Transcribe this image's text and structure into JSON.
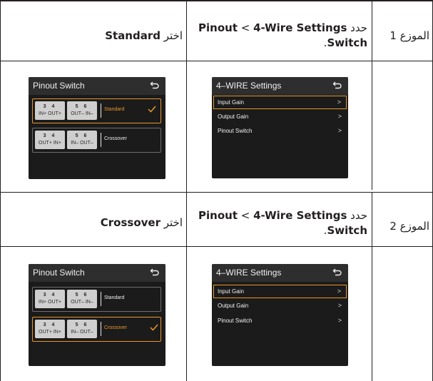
{
  "rows": [
    {
      "step": "الموزع 1",
      "instruction": {
        "prefix": "حدد ",
        "b1": "Pinout",
        "sep": " < ",
        "b2": "4-Wire Settings",
        "b3": "Switch",
        "end": "."
      },
      "action": {
        "prefix": "اختر ",
        "value": "Standard"
      }
    },
    {
      "step": "الموزع 2",
      "instruction": {
        "prefix": "حدد ",
        "b1": "Pinout",
        "sep": " < ",
        "b2": "4-Wire Settings",
        "b3": "Switch",
        "end": "."
      },
      "action": {
        "prefix": "اختر ",
        "value": "Crossover"
      }
    }
  ],
  "settings_screen": {
    "title": "4–WIRE Settings",
    "items": [
      "Input Gain",
      "Output Gain",
      "Pinout Switch"
    ],
    "chevron": ">",
    "selected_index": 0
  },
  "pinout_screen": {
    "title": "Pinout Switch",
    "standard": {
      "nums_a": "3 4",
      "labels_a": "IN+ OUT+",
      "nums_b": "5 6",
      "labels_b": "OUT– IN–",
      "label": "Standard"
    },
    "crossover": {
      "nums_a": "3 4",
      "labels_a": "OUT+ IN+",
      "nums_b": "5 6",
      "labels_b": "IN– OUT–",
      "label": "Crossover"
    }
  },
  "colors": {
    "accent": "#e8972b",
    "screen_bg": "#1b1b1b",
    "rule": "#231f20"
  },
  "icons": [
    "back-arrow-icon",
    "checkmark-icon",
    "chevron-right-icon"
  ]
}
